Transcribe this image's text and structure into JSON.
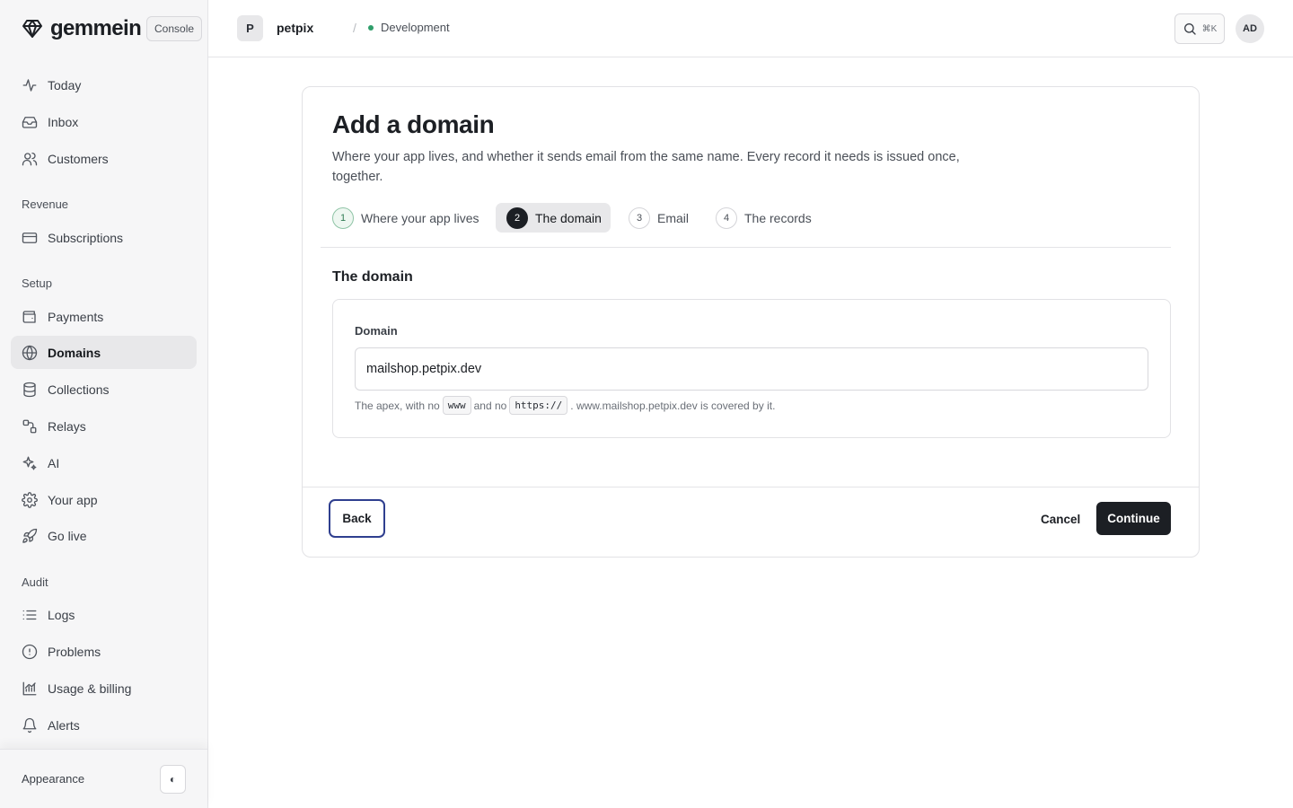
{
  "app": {
    "brand": "gemmein",
    "console_label": "Console"
  },
  "sidebar": {
    "main": [
      {
        "label": "Today",
        "icon": "activity-icon"
      },
      {
        "label": "Inbox",
        "icon": "inbox-icon"
      },
      {
        "label": "Customers",
        "icon": "users-icon"
      }
    ],
    "revenue_label": "Revenue",
    "revenue": [
      {
        "label": "Subscriptions",
        "icon": "credit-card-icon"
      }
    ],
    "setup_label": "Setup",
    "setup": [
      {
        "label": "Payments",
        "icon": "wallet-icon"
      },
      {
        "label": "Domains",
        "icon": "globe-icon",
        "active": true
      },
      {
        "label": "Collections",
        "icon": "database-icon"
      },
      {
        "label": "Relays",
        "icon": "route-icon"
      },
      {
        "label": "AI",
        "icon": "sparkles-icon"
      },
      {
        "label": "Your app",
        "icon": "gear-icon"
      },
      {
        "label": "Go live",
        "icon": "rocket-icon"
      }
    ],
    "audit_label": "Audit",
    "audit": [
      {
        "label": "Logs",
        "icon": "list-icon"
      },
      {
        "label": "Problems",
        "icon": "alert-circle-icon"
      },
      {
        "label": "Usage & billing",
        "icon": "chart-icon"
      },
      {
        "label": "Alerts",
        "icon": "bell-icon"
      }
    ],
    "appearance_label": "Appearance",
    "theme_toggle_glyph": "◐"
  },
  "topbar": {
    "project_initial": "P",
    "project_name": "petpix",
    "separator": "/",
    "environment": "Development",
    "environment_color": "#2f9e6a",
    "search_shortcut": "⌘K",
    "user_initials": "AD"
  },
  "card": {
    "title": "Add a domain",
    "description": "Where your app lives, and whether it sends email from the same name. Every record it needs is issued once, together.",
    "steps": [
      {
        "num": "1",
        "label": "Where your app lives",
        "state": "done"
      },
      {
        "num": "2",
        "label": "The domain",
        "state": "active"
      },
      {
        "num": "3",
        "label": "Email",
        "state": "pending"
      },
      {
        "num": "4",
        "label": "The records",
        "state": "pending"
      }
    ],
    "section_title": "The domain",
    "field": {
      "label": "Domain",
      "value": "mailshop.petpix.dev",
      "help_1": "The apex, with no",
      "code_1": "www",
      "help_2": "and no",
      "code_2": "https://",
      "help_3": ". www.mailshop.petpix.dev is covered by it."
    },
    "buttons": {
      "back": "Back",
      "cancel": "Cancel",
      "continue": "Continue"
    }
  }
}
